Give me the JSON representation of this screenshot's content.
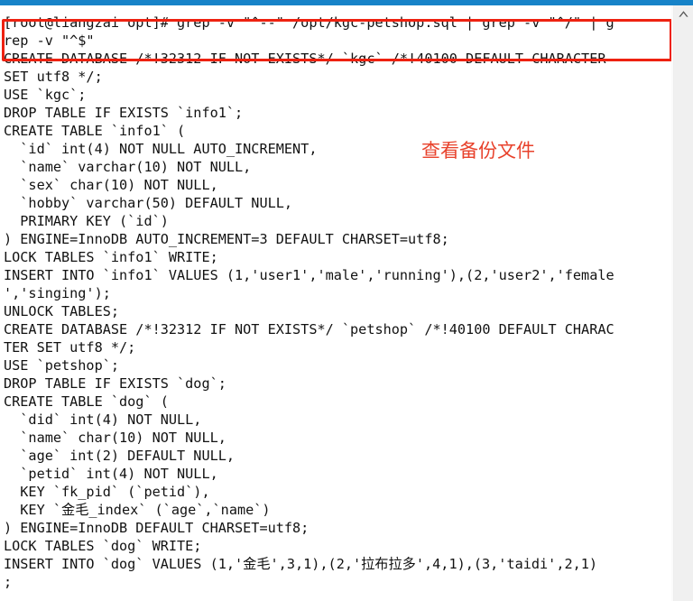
{
  "window": {
    "accent_color": "#1783c8",
    "background_color": "#ffffff",
    "text_color": "#121212"
  },
  "terminal": {
    "prompt": "[root@liangzai opt]#",
    "command": "grep -v \"^--\" /opt/kgc-petshop.sql | grep -v \"^/\" | grep -v \"^$\"",
    "output_text": "[root@liangzai opt]# grep -v \"^--\" /opt/kgc-petshop.sql | grep -v \"^/\" | g\nrep -v \"^$\"\nCREATE DATABASE /*!32312 IF NOT EXISTS*/ `kgc` /*!40100 DEFAULT CHARACTER\nSET utf8 */;\nUSE `kgc`;\nDROP TABLE IF EXISTS `info1`;\nCREATE TABLE `info1` (\n  `id` int(4) NOT NULL AUTO_INCREMENT,\n  `name` varchar(10) NOT NULL,\n  `sex` char(10) NOT NULL,\n  `hobby` varchar(50) DEFAULT NULL,\n  PRIMARY KEY (`id`)\n) ENGINE=InnoDB AUTO_INCREMENT=3 DEFAULT CHARSET=utf8;\nLOCK TABLES `info1` WRITE;\nINSERT INTO `info1` VALUES (1,'user1','male','running'),(2,'user2','female\n','singing');\nUNLOCK TABLES;\nCREATE DATABASE /*!32312 IF NOT EXISTS*/ `petshop` /*!40100 DEFAULT CHARAC\nTER SET utf8 */;\nUSE `petshop`;\nDROP TABLE IF EXISTS `dog`;\nCREATE TABLE `dog` (\n  `did` int(4) NOT NULL,\n  `name` char(10) NOT NULL,\n  `age` int(2) DEFAULT NULL,\n  `petid` int(4) NOT NULL,\n  KEY `fk_pid` (`petid`),\n  KEY `金毛_index` (`age`,`name`)\n) ENGINE=InnoDB DEFAULT CHARSET=utf8;\nLOCK TABLES `dog` WRITE;\nINSERT INTO `dog` VALUES (1,'金毛',3,1),(2,'拉布拉多',4,1),(3,'taidi',2,1)\n;",
    "lines": [
      "[root@liangzai opt]# grep -v \"^--\" /opt/kgc-petshop.sql | grep -v \"^/\" | g",
      "rep -v \"^$\"",
      "CREATE DATABASE /*!32312 IF NOT EXISTS*/ `kgc` /*!40100 DEFAULT CHARACTER",
      "SET utf8 */;",
      "USE `kgc`;",
      "DROP TABLE IF EXISTS `info1`;",
      "CREATE TABLE `info1` (",
      "  `id` int(4) NOT NULL AUTO_INCREMENT,",
      "  `name` varchar(10) NOT NULL,",
      "  `sex` char(10) NOT NULL,",
      "  `hobby` varchar(50) DEFAULT NULL,",
      "  PRIMARY KEY (`id`)",
      ") ENGINE=InnoDB AUTO_INCREMENT=3 DEFAULT CHARSET=utf8;",
      "LOCK TABLES `info1` WRITE;",
      "INSERT INTO `info1` VALUES (1,'user1','male','running'),(2,'user2','female",
      "','singing');",
      "UNLOCK TABLES;",
      "CREATE DATABASE /*!32312 IF NOT EXISTS*/ `petshop` /*!40100 DEFAULT CHARAC",
      "TER SET utf8 */;",
      "USE `petshop`;",
      "DROP TABLE IF EXISTS `dog`;",
      "CREATE TABLE `dog` (",
      "  `did` int(4) NOT NULL,",
      "  `name` char(10) NOT NULL,",
      "  `age` int(2) DEFAULT NULL,",
      "  `petid` int(4) NOT NULL,",
      "  KEY `fk_pid` (`petid`),",
      "  KEY `金毛_index` (`age`,`name`)",
      ") ENGINE=InnoDB DEFAULT CHARSET=utf8;",
      "LOCK TABLES `dog` WRITE;",
      "INSERT INTO `dog` VALUES (1,'金毛',3,1),(2,'拉布拉多',4,1),(3,'taidi',2,1)",
      ";"
    ]
  },
  "annotations": {
    "note_text": "查看备份文件",
    "note_color": "#e8422c",
    "highlight_box_color": "#ee2211"
  },
  "scrollbar": {
    "up_arrow_icon": "chevron-up-icon",
    "arrow_color": "#555555"
  }
}
